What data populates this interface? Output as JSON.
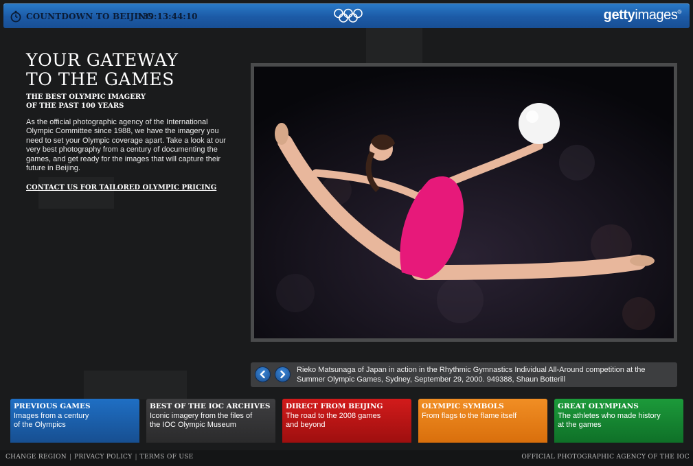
{
  "header": {
    "countdown_label": "COUNTDOWN TO BEIJING",
    "countdown_value": "139:13:44:10",
    "brand_bold": "getty",
    "brand_light": "images",
    "brand_mark": "®",
    "icons": {
      "timer": "stopwatch-icon",
      "rings": "olympic-rings-icon"
    },
    "accent_color": "#1c5aa6"
  },
  "intro": {
    "headline_line1": "YOUR GATEWAY",
    "headline_line2": "TO THE GAMES",
    "subhead_line1": "THE BEST OLYMPIC IMAGERY",
    "subhead_line2": "OF THE PAST 100 YEARS",
    "body": "As the official photographic agency of the International Olympic Committee since 1988, we have the imagery you need to set your Olympic coverage apart. Take a look at our very best photography from a century of documenting the games, and get ready for the images that will capture their future in Beijing.",
    "contact_link": "CONTACT US FOR TAILORED OLYMPIC PRICING"
  },
  "slideshow": {
    "caption": "Rieko Matsunaga of Japan in action in the Rhythmic Gymnastics Individual All-Around competition at the Summer Olympic Games, Sydney, September 29, 2000. 949388, Shaun Botterill",
    "prev_icon": "chevron-left-icon",
    "next_icon": "chevron-right-icon"
  },
  "tiles": [
    {
      "title": "PREVIOUS GAMES",
      "desc": "Images from a century\nof the Olympics",
      "color": "#1f6fc4"
    },
    {
      "title": "BEST OF THE IOC ARCHIVES",
      "desc": "Iconic imagery from the files of\nthe IOC Olympic Museum",
      "color": "#3f3f41"
    },
    {
      "title": "DIRECT FROM BEIJING",
      "desc": "The road to the 2008 games\nand beyond",
      "color": "#d21b1b"
    },
    {
      "title": "OLYMPIC SYMBOLS",
      "desc": "From flags to the flame itself",
      "color": "#f18e24"
    },
    {
      "title": "GREAT OLYMPIANS",
      "desc": "The athletes who made history\nat the games",
      "color": "#1c9a3a"
    }
  ],
  "footer": {
    "links": [
      "CHANGE REGION",
      "PRIVACY POLICY",
      "TERMS OF USE"
    ],
    "separator": "|",
    "right_text": "OFFICIAL PHOTOGRAPHIC AGENCY OF THE IOC"
  }
}
